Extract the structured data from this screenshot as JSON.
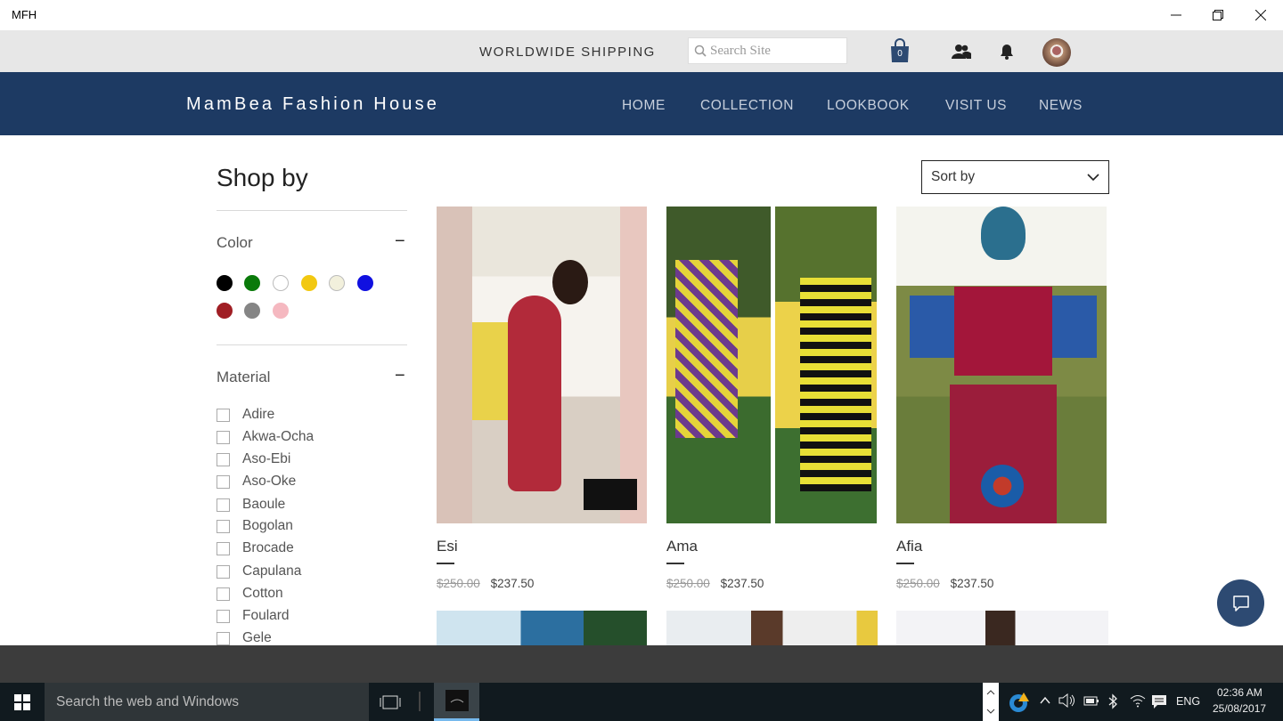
{
  "window": {
    "title": "MFH"
  },
  "topbar": {
    "shipping": "WORLDWIDE SHIPPING",
    "search_placeholder": "Search Site",
    "cart_count": "0"
  },
  "nav": {
    "brand": "MamBea Fashion House",
    "links": [
      "HOME",
      "COLLECTION",
      "LOOKBOOK",
      "VISIT US",
      "NEWS"
    ]
  },
  "sidebar": {
    "heading": "Shop by",
    "color_title": "Color",
    "colors": [
      "#000000",
      "#0a7a0a",
      "#ffffff",
      "#f2c811",
      "#f2f0dc",
      "#1010e0",
      "#a01e24",
      "#858585",
      "#f5b8c0"
    ],
    "material_title": "Material",
    "materials": [
      "Adire",
      "Akwa-Ocha",
      "Aso-Ebi",
      "Aso-Oke",
      "Baoule",
      "Bogolan",
      "Brocade",
      "Capulana",
      "Cotton",
      "Foulard",
      "Gele"
    ]
  },
  "sort": {
    "label": "Sort by"
  },
  "products": [
    {
      "name": "Esi",
      "old_price": "$250.00",
      "price": "$237.50"
    },
    {
      "name": "Ama",
      "old_price": "$250.00",
      "price": "$237.50"
    },
    {
      "name": "Afia",
      "old_price": "$250.00",
      "price": "$237.50"
    }
  ],
  "taskbar": {
    "search": "Search the web and Windows",
    "lang": "ENG",
    "time": "02:36 AM",
    "date": "25/08/2017"
  },
  "colors": {
    "nav_bg": "#1d3a63",
    "topbar_bg": "#e7e7e7",
    "chat_bg": "#2d4a72"
  }
}
